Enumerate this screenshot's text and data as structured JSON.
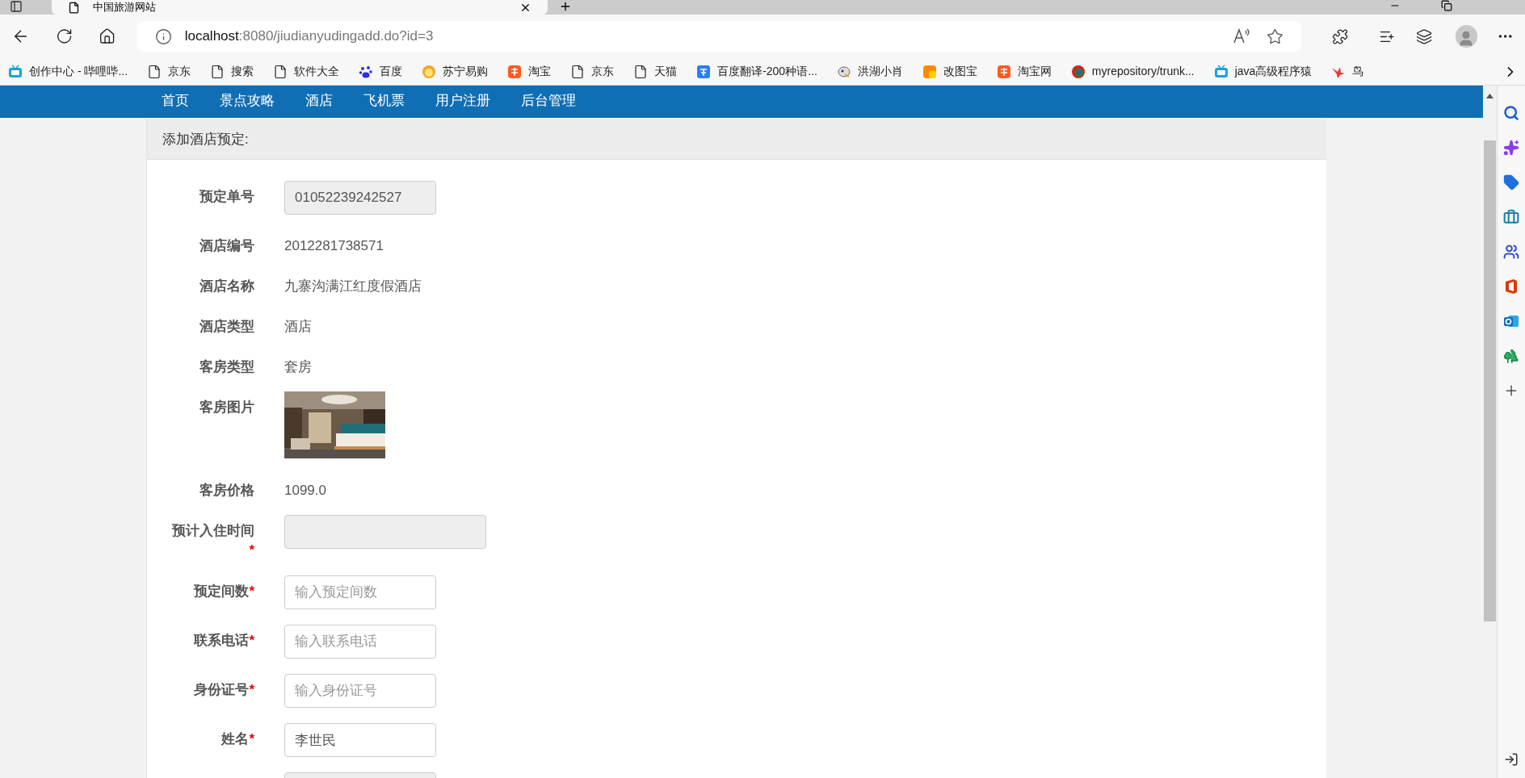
{
  "browser": {
    "tab_title": "中国旅游网站",
    "url_host": "localhost",
    "url_path": ":8080/jiudianyudingadd.do?id=3"
  },
  "bookmarks": [
    {
      "label": "创作中心 - 哔哩哔...",
      "kind": "tv"
    },
    {
      "label": "京东",
      "kind": "page"
    },
    {
      "label": "搜索",
      "kind": "page"
    },
    {
      "label": "软件大全",
      "kind": "page"
    },
    {
      "label": "百度",
      "kind": "paw"
    },
    {
      "label": "苏宁易购",
      "kind": "mascot"
    },
    {
      "label": "淘宝",
      "kind": "tao"
    },
    {
      "label": "京东",
      "kind": "page"
    },
    {
      "label": "天猫",
      "kind": "page"
    },
    {
      "label": "百度翻译-200种语...",
      "kind": "translate"
    },
    {
      "label": "洪湖小肖",
      "kind": "cartoon"
    },
    {
      "label": "改图宝",
      "kind": "tile"
    },
    {
      "label": "淘宝网",
      "kind": "tao"
    },
    {
      "label": "myrepository/trunk...",
      "kind": "globe"
    },
    {
      "label": "java高级程序猿",
      "kind": "tv"
    },
    {
      "label": "鸟",
      "kind": "swallow"
    }
  ],
  "nav": [
    "首页",
    "景点攻略",
    "酒店",
    "飞机票",
    "用户注册",
    "后台管理"
  ],
  "panel": {
    "title": "添加酒店预定:"
  },
  "form": [
    {
      "kind": "field",
      "label": "预定单号",
      "value": "01052239242527",
      "disabled": true
    },
    {
      "kind": "text",
      "label": "酒店编号",
      "value": "2012281738571"
    },
    {
      "kind": "text",
      "label": "酒店名称",
      "value": "九寨沟满江红度假酒店"
    },
    {
      "kind": "text",
      "label": "酒店类型",
      "value": "酒店"
    },
    {
      "kind": "text",
      "label": "客房类型",
      "value": "套房"
    },
    {
      "label": "客房图片"
    },
    {
      "kind": "text",
      "label": "客房价格",
      "value": "1099.0"
    },
    {
      "kind": "date",
      "label": "预计入住时间",
      "mark": "*",
      "disabled": true
    },
    {
      "kind": "field",
      "label": "预定间数",
      "mark": "*",
      "placeholder": "输入预定间数",
      "disabled": false
    },
    {
      "kind": "field",
      "label": "联系电话",
      "mark": "*",
      "placeholder": "输入联系电话",
      "disabled": false
    },
    {
      "kind": "field",
      "label": "身份证号",
      "mark": "*",
      "placeholder": "输入身份证号",
      "disabled": false
    },
    {
      "kind": "field",
      "label": "姓名",
      "mark": "*",
      "value": "李世民",
      "disabled": false
    },
    {
      "kind": "field",
      "disabled": true
    }
  ]
}
